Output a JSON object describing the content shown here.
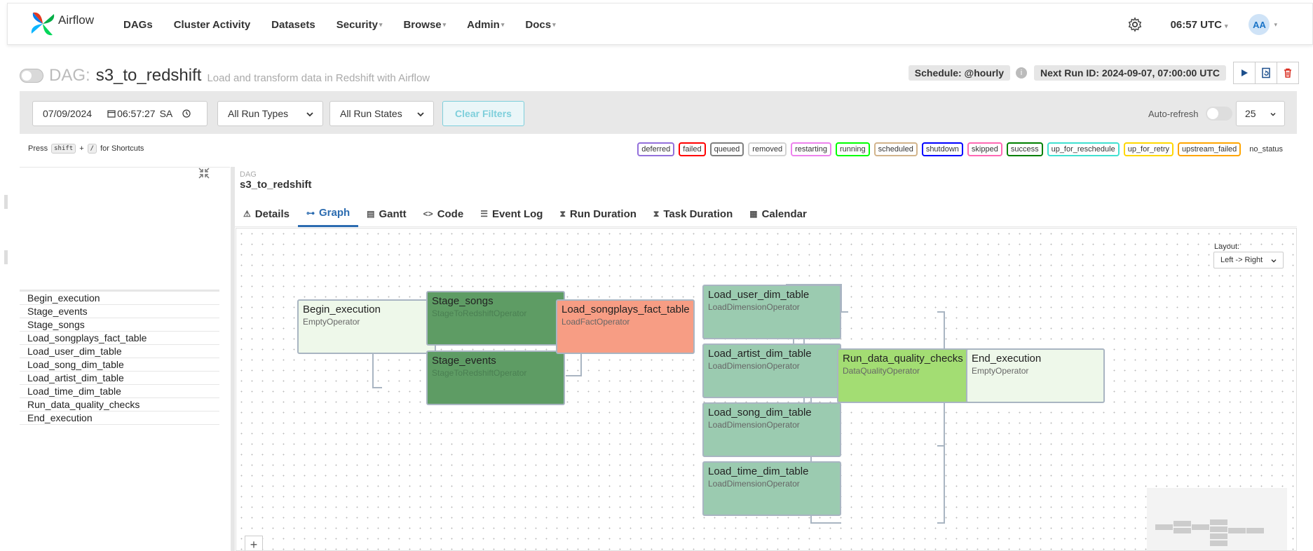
{
  "nav": {
    "brand": "Airflow",
    "items": [
      {
        "label": "DAGs",
        "caret": false
      },
      {
        "label": "Cluster Activity",
        "caret": false
      },
      {
        "label": "Datasets",
        "caret": false
      },
      {
        "label": "Security",
        "caret": true
      },
      {
        "label": "Browse",
        "caret": true
      },
      {
        "label": "Admin",
        "caret": true
      },
      {
        "label": "Docs",
        "caret": true
      }
    ],
    "time": "06:57 UTC",
    "avatar": "AA"
  },
  "dag": {
    "label": "DAG:",
    "id": "s3_to_redshift",
    "description": "Load and transform data in Redshift with Airflow",
    "schedule": "Schedule: @hourly",
    "info": "i",
    "next_run": "Next Run ID: 2024-09-07, 07:00:00 UTC"
  },
  "filters": {
    "date": "07/09/2024",
    "time": "06:57:27",
    "ampm": "SA",
    "run_types": "All Run Types",
    "run_states": "All Run States",
    "clear": "Clear Filters",
    "auto_refresh": "Auto-refresh",
    "rows": "25"
  },
  "shortcuts": {
    "press": "Press",
    "key1": "shift",
    "plus": "+",
    "key2": "/",
    "suffix": "for Shortcuts"
  },
  "legend": [
    {
      "label": "deferred",
      "color": "#9370db"
    },
    {
      "label": "failed",
      "color": "#ff0000"
    },
    {
      "label": "queued",
      "color": "#808080"
    },
    {
      "label": "removed",
      "color": "#d3d3d3"
    },
    {
      "label": "restarting",
      "color": "#ee82ee"
    },
    {
      "label": "running",
      "color": "#00ff00"
    },
    {
      "label": "scheduled",
      "color": "#d2b48c"
    },
    {
      "label": "shutdown",
      "color": "#0000ff"
    },
    {
      "label": "skipped",
      "color": "#ff69b4"
    },
    {
      "label": "success",
      "color": "#008000"
    },
    {
      "label": "up_for_reschedule",
      "color": "#40e0d0"
    },
    {
      "label": "up_for_retry",
      "color": "#ffd700"
    },
    {
      "label": "upstream_failed",
      "color": "#ffa500"
    },
    {
      "label": "no_status",
      "color": "#ffffff"
    }
  ],
  "tasks": [
    "Begin_execution",
    "Stage_events",
    "Stage_songs",
    "Load_songplays_fact_table",
    "Load_user_dim_table",
    "Load_song_dim_table",
    "Load_artist_dim_table",
    "Load_time_dim_table",
    "Run_data_quality_checks",
    "End_execution"
  ],
  "details": {
    "crumb_small": "DAG",
    "crumb_main": "s3_to_redshift"
  },
  "tabs": [
    {
      "label": "Details",
      "icon": "⚠",
      "active": false
    },
    {
      "label": "Graph",
      "icon": "⊶",
      "active": true
    },
    {
      "label": "Gantt",
      "icon": "▤",
      "active": false
    },
    {
      "label": "Code",
      "icon": "<>",
      "active": false
    },
    {
      "label": "Event Log",
      "icon": "☰",
      "active": false
    },
    {
      "label": "Run Duration",
      "icon": "⧗",
      "active": false
    },
    {
      "label": "Task Duration",
      "icon": "⧗",
      "active": false
    },
    {
      "label": "Calendar",
      "icon": "▦",
      "active": false
    }
  ],
  "graph": {
    "layout_label": "Layout:",
    "layout_value": "Left -> Right",
    "zoom_in": "+",
    "nodes": [
      {
        "name": "Begin_execution",
        "operator": "EmptyOperator",
        "bg": "#eef8ea"
      },
      {
        "name": "Stage_songs",
        "operator": "StageToRedshiftOperator",
        "bg": "#5e9c64"
      },
      {
        "name": "Stage_events",
        "operator": "StageToRedshiftOperator",
        "bg": "#5e9c64"
      },
      {
        "name": "Load_songplays_fact_table",
        "operator": "LoadFactOperator",
        "bg": "#f79d84"
      },
      {
        "name": "Load_user_dim_table",
        "operator": "LoadDimensionOperator",
        "bg": "#9bcbb0"
      },
      {
        "name": "Load_artist_dim_table",
        "operator": "LoadDimensionOperator",
        "bg": "#9bcbb0"
      },
      {
        "name": "Load_song_dim_table",
        "operator": "LoadDimensionOperator",
        "bg": "#9bcbb0"
      },
      {
        "name": "Load_time_dim_table",
        "operator": "LoadDimensionOperator",
        "bg": "#9bcbb0"
      },
      {
        "name": "Run_data_quality_checks",
        "operator": "DataQualityOperator",
        "bg": "#a3dd73"
      },
      {
        "name": "End_execution",
        "operator": "EmptyOperator",
        "bg": "#eef8ea"
      }
    ]
  }
}
